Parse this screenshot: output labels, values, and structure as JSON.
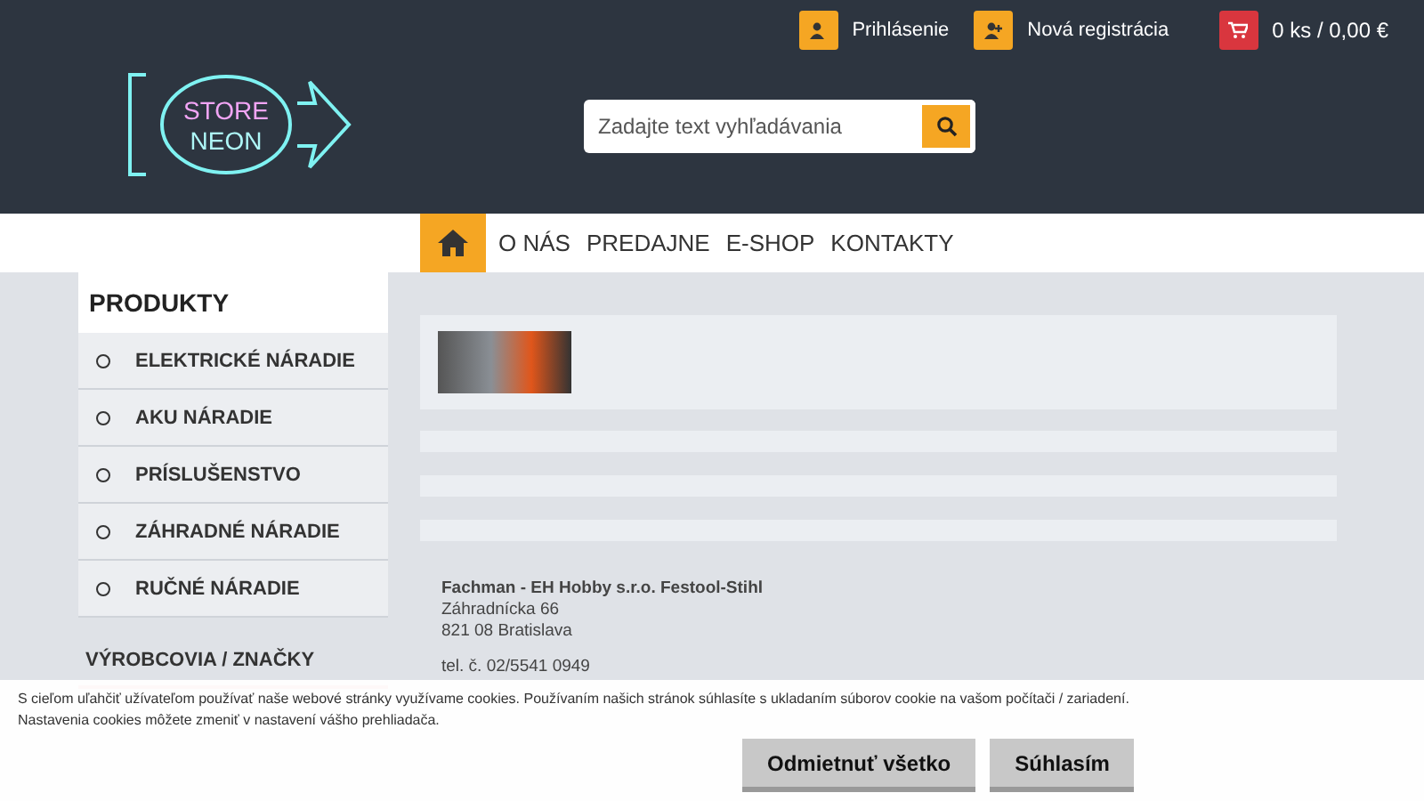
{
  "header": {
    "logo": {
      "line_1": "STORE",
      "line_2": "NEON"
    },
    "account_links": [
      {
        "label": "Prihlásenie",
        "kind": "login"
      },
      {
        "label": "Nová registrácia",
        "kind": "register"
      }
    ],
    "cart": {
      "label": "0 ks / 0,00 €"
    },
    "search": {
      "placeholder": "Zadajte text vyhľadávania"
    }
  },
  "nav": {
    "items": [
      {
        "label": "O NÁS"
      },
      {
        "label": "PREDAJNE"
      },
      {
        "label": "E-SHOP"
      },
      {
        "label": "KONTAKTY"
      }
    ]
  },
  "sidebar": {
    "title": "PRODUKTY",
    "items": [
      {
        "label": "ELEKTRICKÉ NÁRADIE"
      },
      {
        "label": "AKU NÁRADIE"
      },
      {
        "label": "PRÍSLUŠENSTVO"
      },
      {
        "label": "ZÁHRADNÉ NÁRADIE"
      },
      {
        "label": "RUČNÉ NÁRADIE"
      }
    ],
    "brands_title": "VÝROBCOVIA / ZNAČKY"
  },
  "content": {
    "contact": {
      "company": "Fachman - EH Hobby s.r.o. Festool-Stihl",
      "street": "Záhradnícka 66",
      "city": "821 08 Bratislava",
      "phone": "tel. č. 02/5541 0949"
    }
  },
  "cookie_banner": {
    "lines": [
      "S cieľom uľahčiť užívateľom používať naše webové stránky využívame cookies. Používaním našich stránok súhlasíte s ukladaním súborov cookie na vašom počítači / zariadení.",
      "Nastavenia cookies môžete zmeniť v nastavení vášho prehliadača."
    ],
    "buttons": [
      "Odmietnuť všetko",
      "Súhlasím"
    ]
  }
}
